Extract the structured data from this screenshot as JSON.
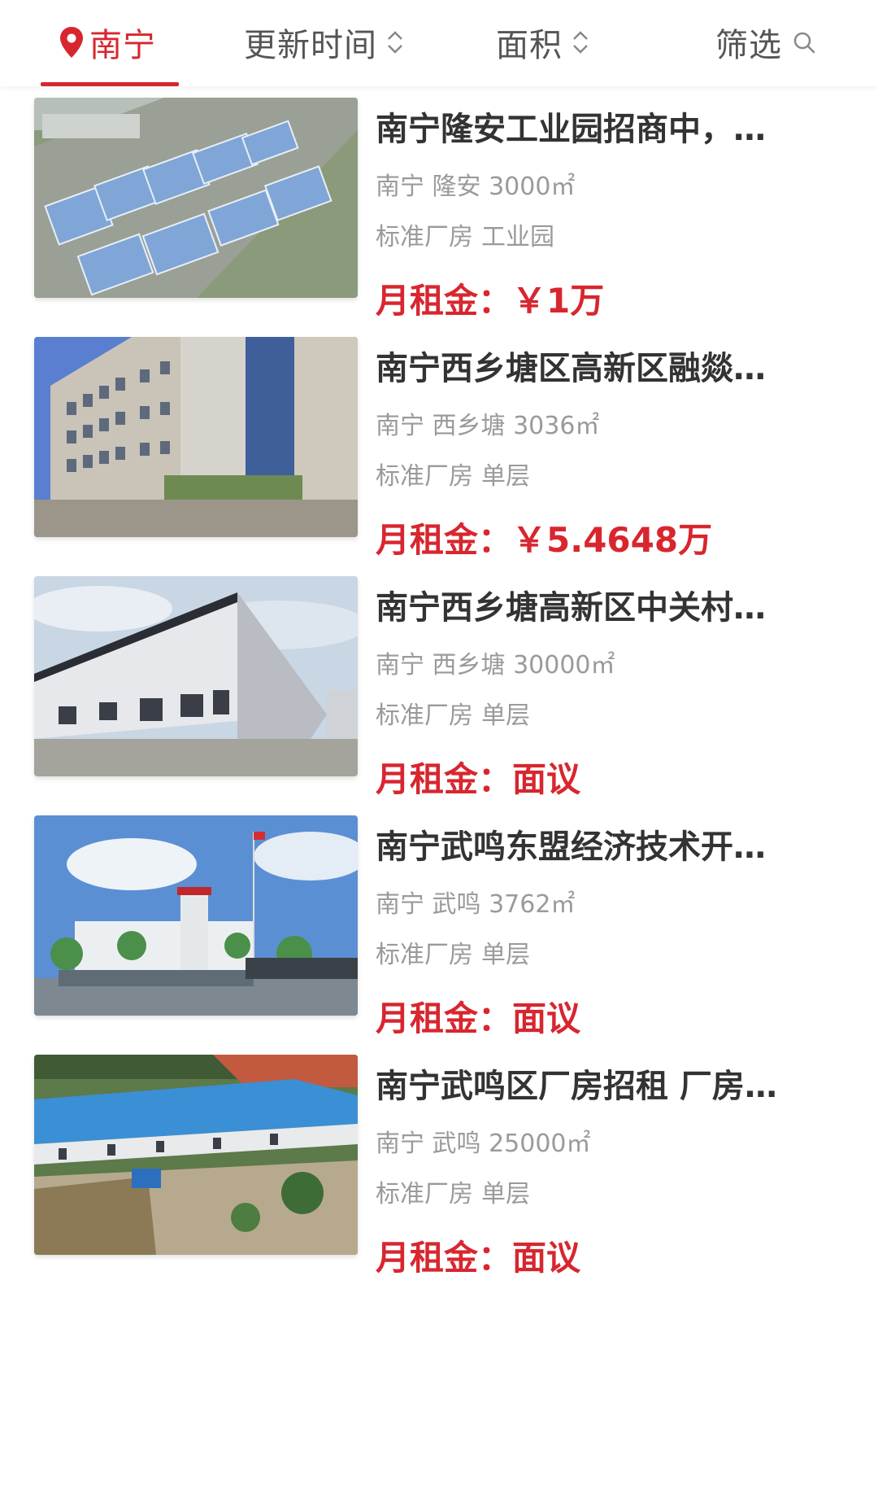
{
  "filter_bar": {
    "city": "南宁",
    "sort_update": "更新时间",
    "sort_area": "面积",
    "filter": "筛选",
    "accent": "#d8262f"
  },
  "listings": [
    {
      "title": "南宁隆安工业园招商中，…",
      "location": "南宁 隆安 3000㎡",
      "tags": [
        "标准厂房",
        "工业园"
      ],
      "price_label": "月租金：",
      "price": "￥1万",
      "image": "aerial-industrial-park-photo"
    },
    {
      "title": "南宁西乡塘区高新区融燚…",
      "location": "南宁 西乡塘 3036㎡",
      "tags": [
        "标准厂房",
        "单层"
      ],
      "price_label": "月租金：",
      "price": "￥5.4648万",
      "image": "multi-storey-factory-photo"
    },
    {
      "title": "南宁西乡塘高新区中关村…",
      "location": "南宁 西乡塘 30000㎡",
      "tags": [
        "标准厂房",
        "单层"
      ],
      "price_label": "月租金：",
      "price": "面议",
      "image": "large-steel-warehouse-photo"
    },
    {
      "title": "南宁武鸣东盟经济技术开…",
      "location": "南宁 武鸣 3762㎡",
      "tags": [
        "标准厂房",
        "单层"
      ],
      "price_label": "月租金：",
      "price": "面议",
      "image": "factory-gate-with-flagpoles-photo"
    },
    {
      "title": "南宁武鸣区厂房招租 厂房…",
      "location": "南宁 武鸣 25000㎡",
      "tags": [
        "标准厂房",
        "单层"
      ],
      "price_label": "月租金：",
      "price": "面议",
      "image": "blue-roof-factory-aerial-photo"
    }
  ]
}
